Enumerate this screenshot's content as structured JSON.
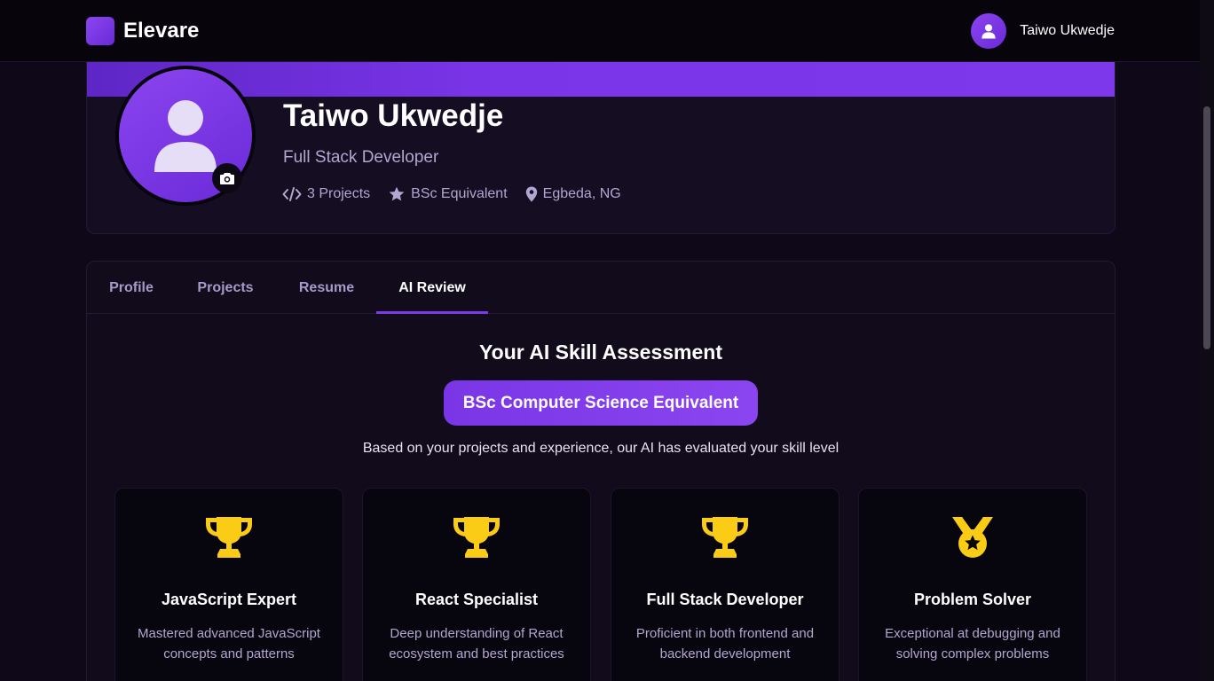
{
  "app": {
    "name": "Elevare"
  },
  "nav": {
    "username": "Taiwo Ukwedje"
  },
  "profile": {
    "name": "Taiwo Ukwedje",
    "role": "Full Stack Developer",
    "meta": {
      "projects": "3 Projects",
      "level": "BSc Equivalent",
      "location": "Egbeda, NG"
    }
  },
  "tabs": [
    {
      "label": "Profile"
    },
    {
      "label": "Projects"
    },
    {
      "label": "Resume"
    },
    {
      "label": "AI Review"
    }
  ],
  "active_tab": "AI Review",
  "ai_review": {
    "title": "Your AI Skill Assessment",
    "level": "BSc Computer Science Equivalent",
    "description": "Based on your projects and experience, our AI has evaluated your skill level",
    "badges": [
      {
        "icon": "trophy-icon",
        "title": "JavaScript Expert",
        "description": "Mastered advanced JavaScript concepts and patterns"
      },
      {
        "icon": "trophy-icon",
        "title": "React Specialist",
        "description": "Deep understanding of React ecosystem and best practices"
      },
      {
        "icon": "trophy-icon",
        "title": "Full Stack Developer",
        "description": "Proficient in both frontend and backend development"
      },
      {
        "icon": "medal-icon",
        "title": "Problem Solver",
        "description": "Exceptional at debugging and solving complex problems"
      }
    ]
  },
  "colors": {
    "accent": "#7c3aed",
    "background": "#0e0818",
    "trophy": "#facc15"
  }
}
